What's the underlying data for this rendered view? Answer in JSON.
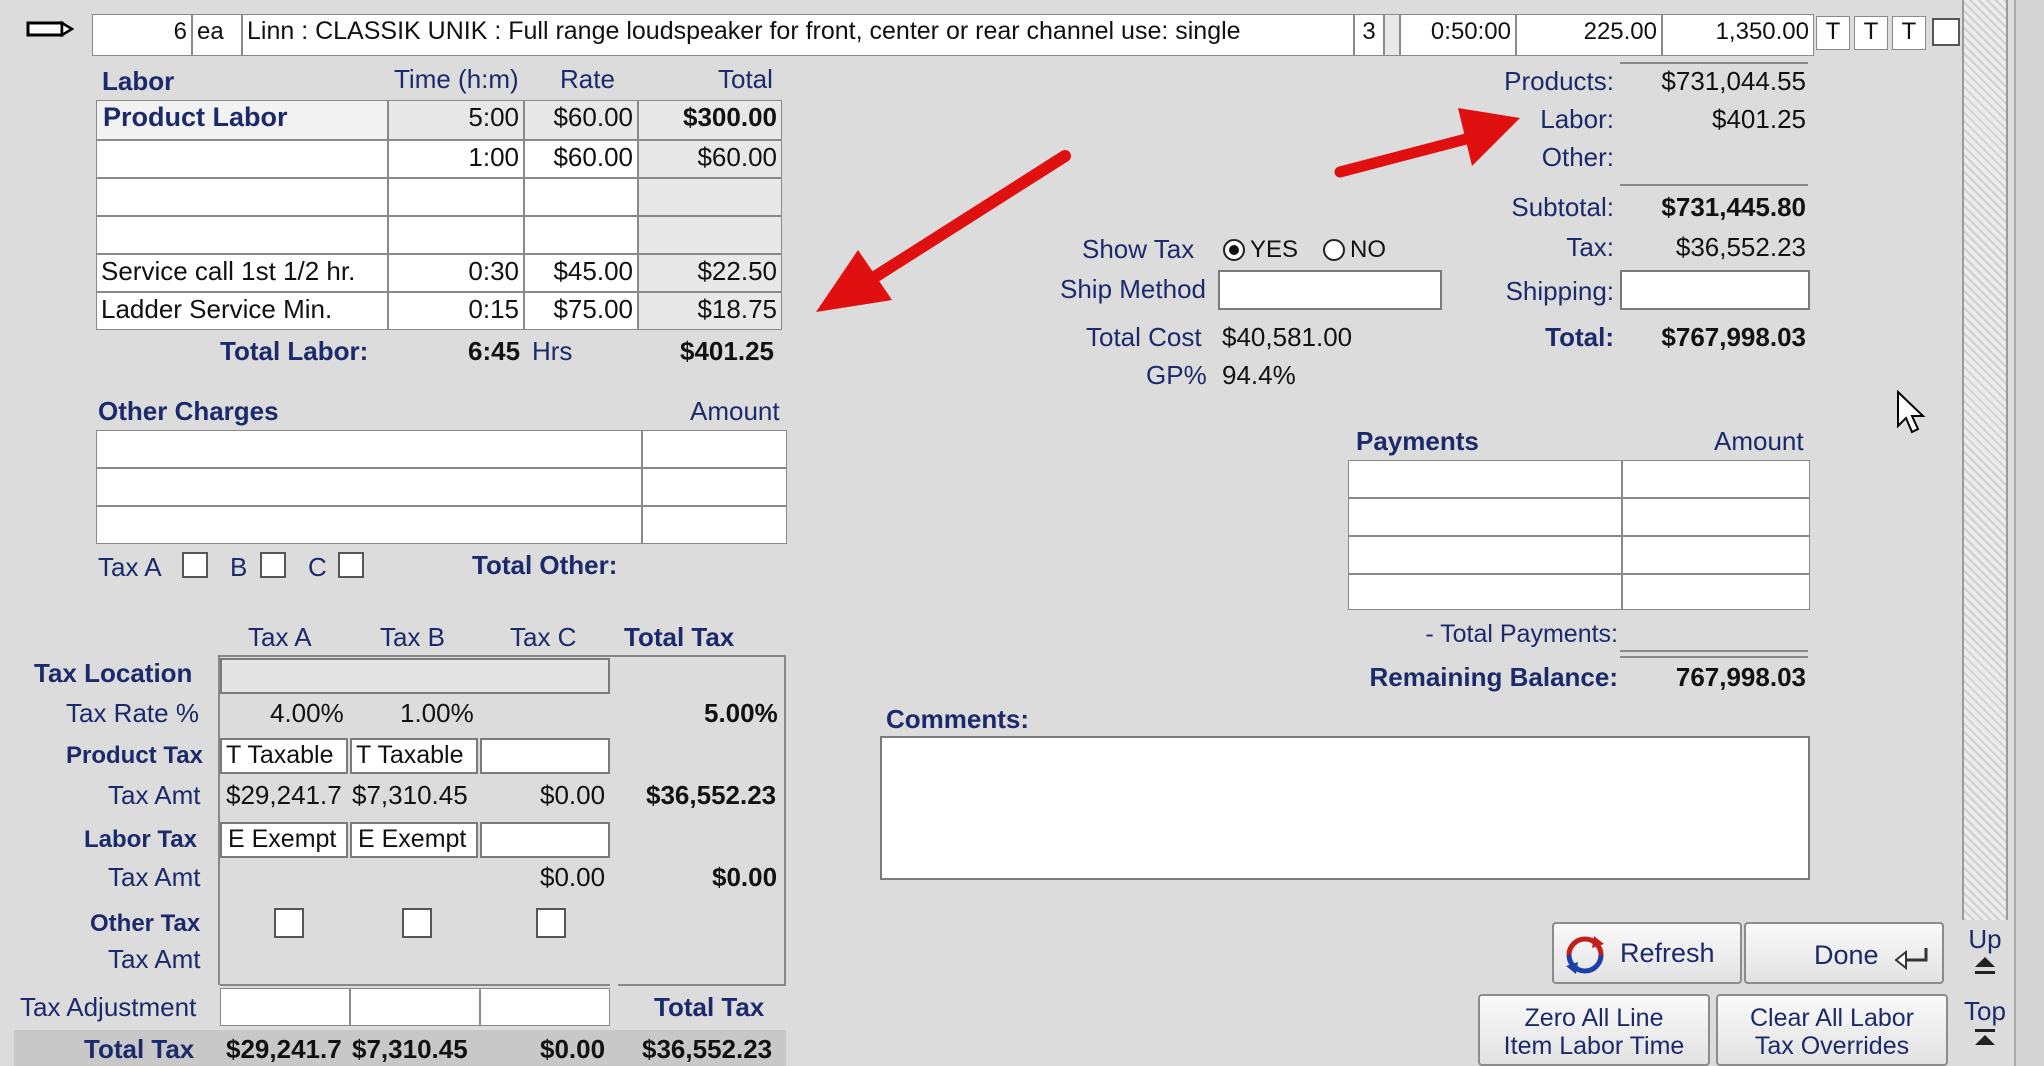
{
  "line_item": {
    "qty": "6",
    "unit": "ea",
    "description": "Linn : CLASSIK UNIK : Full range loudspeaker for front, center or rear channel use: single",
    "qty2": "3",
    "time": "0:50:00",
    "price": "225.00",
    "total": "1,350.00",
    "flags": [
      "T",
      "T",
      "T"
    ]
  },
  "labor": {
    "header": {
      "title": "Labor",
      "time": "Time (h:m)",
      "rate": "Rate",
      "total": "Total"
    },
    "rows": [
      {
        "name": "Product Labor",
        "time": "5:00",
        "rate": "$60.00",
        "total": "$300.00"
      },
      {
        "name": "",
        "time": "1:00",
        "rate": "$60.00",
        "total": "$60.00"
      },
      {
        "name": "",
        "time": "",
        "rate": "",
        "total": ""
      },
      {
        "name": "",
        "time": "",
        "rate": "",
        "total": ""
      },
      {
        "name": "Service call 1st 1/2 hr.",
        "time": "0:30",
        "rate": "$45.00",
        "total": "$22.50"
      },
      {
        "name": "Ladder Service Min.",
        "time": "0:15",
        "rate": "$75.00",
        "total": "$18.75"
      }
    ],
    "total_label": "Total Labor:",
    "total_time": "6:45",
    "total_unit": "Hrs",
    "total_amount": "$401.25"
  },
  "other_charges": {
    "title": "Other Charges",
    "amount_header": "Amount",
    "tax_a": "Tax A",
    "tax_b": "B",
    "tax_c": "C",
    "total_label": "Total Other:"
  },
  "tax": {
    "col_a": "Tax A",
    "col_b": "Tax B",
    "col_c": "Tax C",
    "col_total": "Total Tax",
    "location_label": "Tax Location",
    "rate_label": "Tax Rate %",
    "rate_a": "4.00%",
    "rate_b": "1.00%",
    "rate_total": "5.00%",
    "product_label": "Product Tax",
    "product_a": "T Taxable",
    "product_b": "T Taxable",
    "product_amt_label": "Tax Amt",
    "product_amt_a": "$29,241.7",
    "product_amt_b": "$7,310.45",
    "product_amt_c": "$0.00",
    "product_amt_total": "$36,552.23",
    "labor_label": "Labor Tax",
    "labor_a": "E Exempt",
    "labor_b": "E Exempt",
    "labor_amt_label": "Tax Amt",
    "labor_amt_c": "$0.00",
    "labor_amt_total": "$0.00",
    "other_label": "Other Tax",
    "other_amt_label": "Tax Amt",
    "adjustment_label": "Tax Adjustment",
    "adjustment_total_label": "Total Tax",
    "total_label": "Total Tax",
    "total_a": "$29,241.7",
    "total_b": "$7,310.45",
    "total_c": "$0.00",
    "total_total": "$36,552.23"
  },
  "middle": {
    "show_tax_label": "Show Tax",
    "yes": "YES",
    "no": "NO",
    "ship_method_label": "Ship Method",
    "total_cost_label": "Total Cost",
    "total_cost": "$40,581.00",
    "gp_label": "GP%",
    "gp": "94.4%"
  },
  "summary": {
    "products_label": "Products:",
    "products": "$731,044.55",
    "labor_label": "Labor:",
    "labor": "$401.25",
    "other_label": "Other:",
    "subtotal_label": "Subtotal:",
    "subtotal": "$731,445.80",
    "tax_label": "Tax:",
    "tax": "$36,552.23",
    "shipping_label": "Shipping:",
    "total_label": "Total:",
    "total": "$767,998.03"
  },
  "payments": {
    "title": "Payments",
    "amount_header": "Amount",
    "total_label": "- Total Payments:",
    "remaining_label": "Remaining Balance:",
    "remaining": "767,998.03"
  },
  "comments": {
    "label": "Comments:"
  },
  "buttons": {
    "refresh": "Refresh",
    "done": "Done",
    "zero_line1": "Zero All Line",
    "zero_line2": "Item Labor Time",
    "clear_line1": "Clear All Labor",
    "clear_line2": "Tax Overrides",
    "up": "Up",
    "top": "Top"
  },
  "colors": {
    "label_navy": "#1b2a6b",
    "arrow_red": "#e01010",
    "background": "#dcdcdc"
  }
}
